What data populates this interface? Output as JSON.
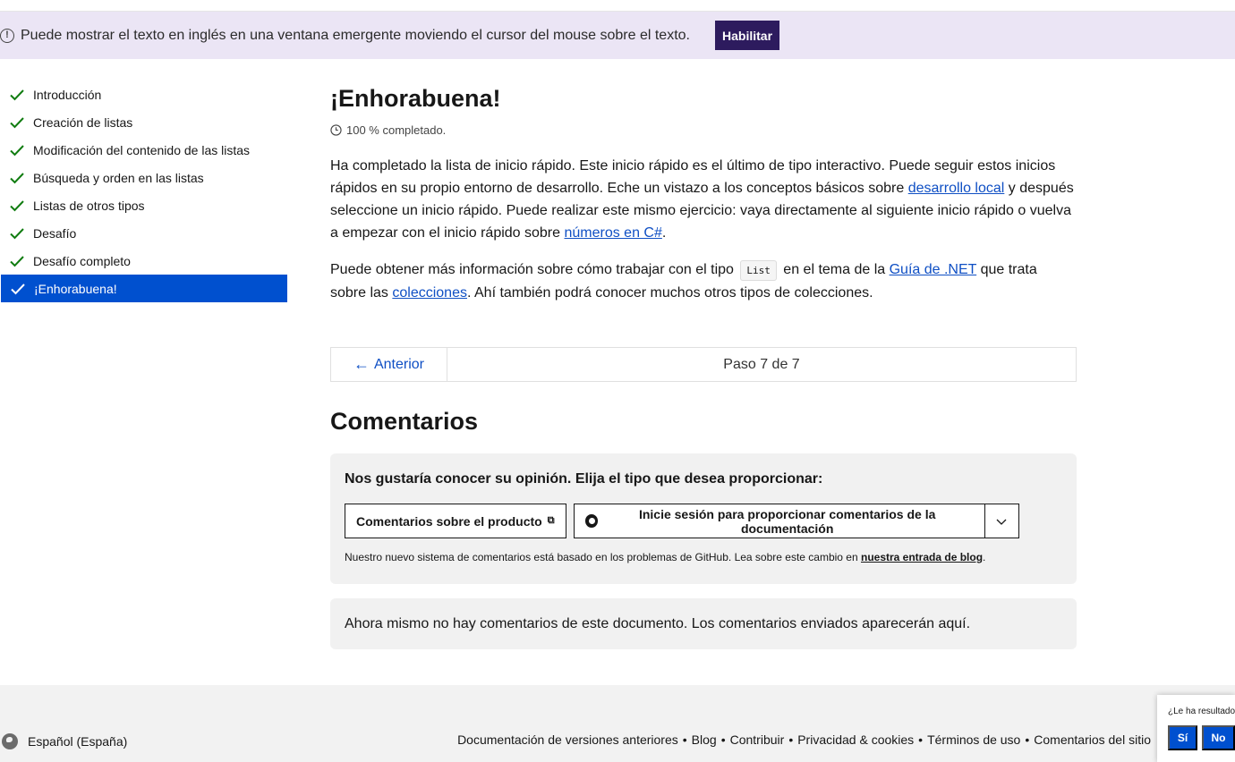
{
  "banner": {
    "text": "Puede mostrar el texto en inglés en una ventana emergente moviendo el cursor del mouse sobre el texto.",
    "enable_label": "Habilitar"
  },
  "sidebar": {
    "items": [
      {
        "label": "Introducción"
      },
      {
        "label": "Creación de listas"
      },
      {
        "label": "Modificación del contenido de las listas"
      },
      {
        "label": "Búsqueda y orden en las listas"
      },
      {
        "label": "Listas de otros tipos"
      },
      {
        "label": "Desafío"
      },
      {
        "label": "Desafío completo"
      },
      {
        "label": "¡Enhorabuena!"
      }
    ],
    "active_index": 7,
    "check_color": "#107c10",
    "active_color": "#0050cf"
  },
  "main": {
    "title": "¡Enhorabuena!",
    "progress": "100 % completado.",
    "p1": {
      "a": "Ha completado la lista de inicio rápido. Este inicio rápido es el último de tipo interactivo. Puede seguir estos inicios rápidos en su propio entorno de desarrollo. Eche un vistazo a los conceptos básicos sobre ",
      "link1": "desarrollo local",
      "b": " y después seleccione un inicio rápido. Puede realizar este mismo ejercicio: vaya directamente al siguiente inicio rápido o vuelva a empezar con el inicio rápido sobre ",
      "link2": "números en C#",
      "c": "."
    },
    "p2": {
      "a": "Puede obtener más información sobre cómo trabajar con el tipo ",
      "code": "List",
      "b": " en el tema de la ",
      "link1": "Guía de .NET",
      "c": " que trata sobre las ",
      "link2": "colecciones",
      "d": ". Ahí también podrá conocer muchos otros tipos de colecciones."
    }
  },
  "pager": {
    "prev_label": "Anterior",
    "step": "Paso 7 de 7"
  },
  "comments": {
    "title": "Comentarios",
    "question": "Nos gustaría conocer su opinión. Elija el tipo que desea proporcionar:",
    "product_btn": "Comentarios sobre el producto",
    "github_btn": "Inicie sesión para proporcionar comentarios de la documentación",
    "note_a": "Nuestro nuevo sistema de comentarios está basado en los problemas de GitHub. Lea sobre este cambio en ",
    "note_link": "nuestra entrada de blog",
    "note_b": ".",
    "empty": "Ahora mismo no hay comentarios de este documento. Los comentarios enviados aparecerán aquí."
  },
  "footer": {
    "language": "Español (España)",
    "links": [
      "Documentación de versiones anteriores",
      "Blog",
      "Contribuir",
      "Privacidad & cookies",
      "Términos de uso",
      "Comentarios del sitio"
    ],
    "separator": "•"
  },
  "rating": {
    "question": "¿Le ha resultado útil esta página?",
    "yes": "Sí",
    "no": "No"
  }
}
